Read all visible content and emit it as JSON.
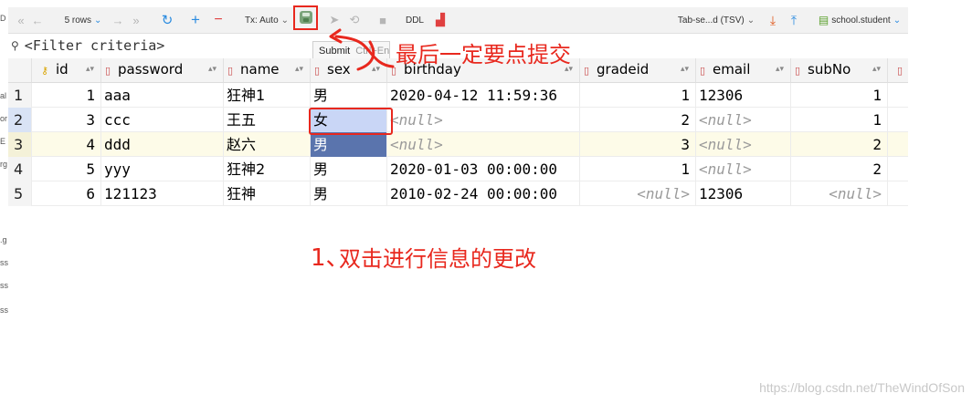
{
  "toolbar": {
    "rows_label": "5 rows",
    "tx_label": "Tx: Auto",
    "ddl_label": "DDL",
    "export_format": "Tab-se...d (TSV)",
    "schema_table": "school.student",
    "icons": [
      "first-icon",
      "prev-icon",
      "next-icon",
      "last-icon",
      "refresh-icon",
      "add-row-icon",
      "delete-row-icon",
      "submit-icon",
      "cancel-icon",
      "revert-icon",
      "stop-icon",
      "compare-icon",
      "download-icon",
      "upload-icon",
      "table-icon"
    ]
  },
  "filter": {
    "placeholder": "<Filter criteria>"
  },
  "tooltip": {
    "label": "Submit",
    "shortcut": "Ctrl+Enter"
  },
  "columns": [
    {
      "name": "id",
      "icon": "key-icon"
    },
    {
      "name": "password",
      "icon": "column-icon"
    },
    {
      "name": "name",
      "icon": "column-icon"
    },
    {
      "name": "sex",
      "icon": "column-icon"
    },
    {
      "name": "birthday",
      "icon": "column-icon"
    },
    {
      "name": "gradeid",
      "icon": "column-icon"
    },
    {
      "name": "email",
      "icon": "column-icon"
    },
    {
      "name": "subNo",
      "icon": "column-icon"
    }
  ],
  "rows": [
    {
      "n": "1",
      "id": "1",
      "password": "aaa",
      "name": "狂神1",
      "sex": "男",
      "birthday": "2020-04-12 11:59:36",
      "gradeid": "1",
      "email": "12306",
      "subNo": "1"
    },
    {
      "n": "2",
      "id": "3",
      "password": "ccc",
      "name": "王五",
      "sex": "女",
      "birthday": "<null>",
      "gradeid": "2",
      "email": "<null>",
      "subNo": "1"
    },
    {
      "n": "3",
      "id": "4",
      "password": "ddd",
      "name": "赵六",
      "sex": "男",
      "birthday": "<null>",
      "gradeid": "3",
      "email": "<null>",
      "subNo": "2"
    },
    {
      "n": "4",
      "id": "5",
      "password": "yyy",
      "name": "狂神2",
      "sex": "男",
      "birthday": "2020-01-03 00:00:00",
      "gradeid": "1",
      "email": "<null>",
      "subNo": "2"
    },
    {
      "n": "5",
      "id": "6",
      "password": "121123",
      "name": "狂神",
      "sex": "男",
      "birthday": "2010-02-24 00:00:00",
      "gradeid": "<null>",
      "email": "12306",
      "subNo": "<null>"
    }
  ],
  "annotations": {
    "submit_note": "最后一定要点提交",
    "edit_note": "双击进行信息的更改",
    "step_mark": "1、"
  },
  "watermark": "https://blog.csdn.net/TheWindOfSon",
  "colors": {
    "annotation": "#e8281e",
    "selected_cell": "#5a74ad",
    "editing_cell": "#c9d6f6",
    "accent_blue": "#2a8be0"
  }
}
